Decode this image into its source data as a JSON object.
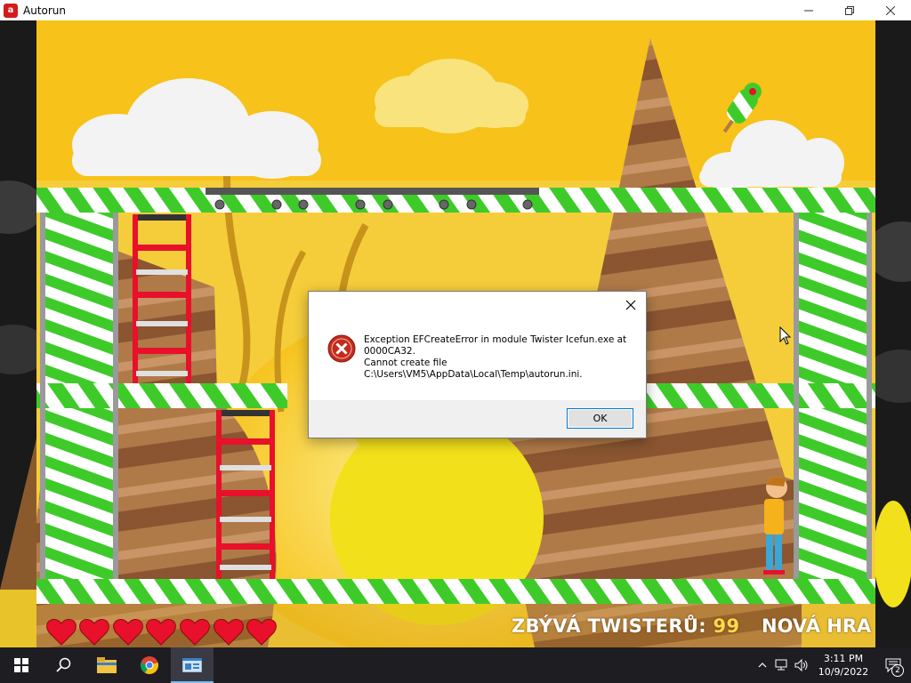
{
  "window": {
    "title": "Autorun",
    "icon": "autorun-app-icon",
    "buttons": [
      "minimize-icon",
      "restore-icon",
      "close-icon"
    ]
  },
  "game": {
    "remaining_label": "ZBÝVÁ TWISTERŮ:",
    "remaining_count": "99",
    "new_game_label": "NOVÁ HRA",
    "lives": 7,
    "colors": {
      "sky": "#f7c21a",
      "stripe_green": "#3ecb2a",
      "heart": "#e8102a",
      "hud_count": "#ffd84a"
    }
  },
  "dialog": {
    "message_line1": "Exception EFCreateError in module Twister Icefun.exe at 0000CA32.",
    "message_line2": "Cannot create file",
    "message_line3": "C:\\Users\\VM5\\AppData\\Local\\Temp\\autorun.ini.",
    "ok_label": "OK",
    "icon": "error-icon"
  },
  "taskbar": {
    "items": [
      "start-icon",
      "search-icon",
      "file-explorer-icon",
      "chrome-icon",
      "autorun-taskbar-icon"
    ],
    "time": "3:11 PM",
    "date": "10/9/2022",
    "notification_count": "2"
  }
}
